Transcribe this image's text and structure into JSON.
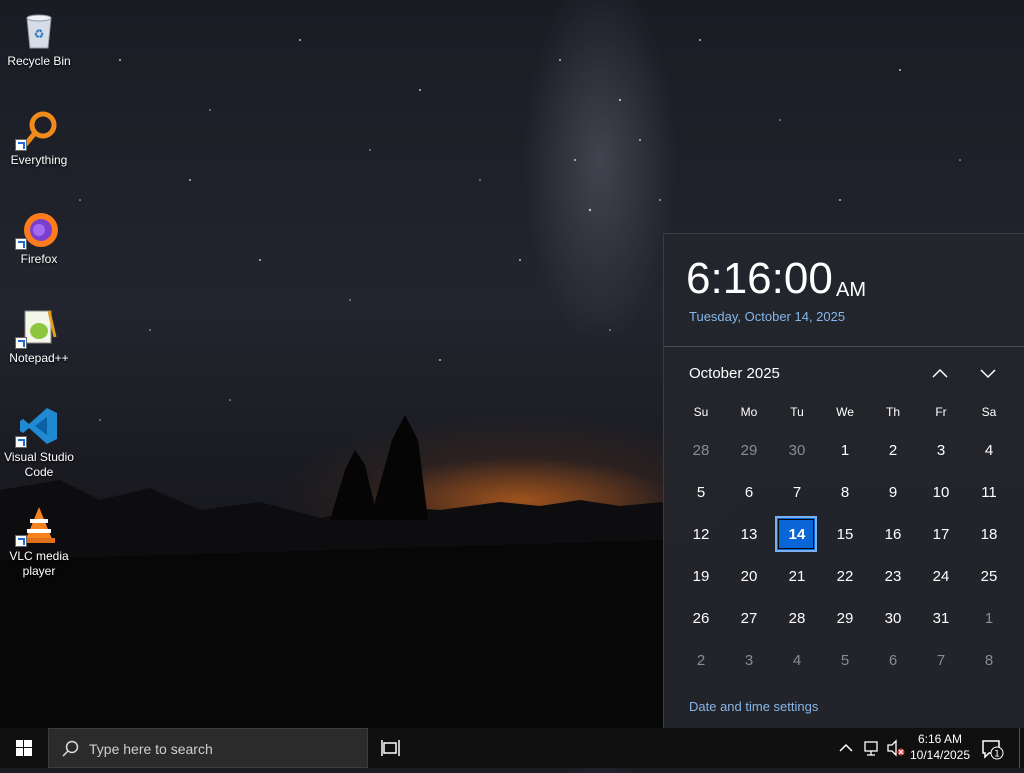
{
  "desktop": {
    "icons": [
      {
        "label_line1": "Recycle Bin",
        "label_line2": "",
        "icon": "recycle-bin-icon"
      },
      {
        "label_line1": "Everything",
        "label_line2": "",
        "icon": "everything-search-icon"
      },
      {
        "label_line1": "Firefox",
        "label_line2": "",
        "icon": "firefox-icon"
      },
      {
        "label_line1": "Notepad++",
        "label_line2": "",
        "icon": "notepad-plus-plus-icon"
      },
      {
        "label_line1": "Visual Studio",
        "label_line2": "Code",
        "icon": "vscode-icon"
      },
      {
        "label_line1": "VLC media",
        "label_line2": "player",
        "icon": "vlc-icon"
      }
    ]
  },
  "calendar": {
    "time": "6:16:00",
    "ampm": "AM",
    "long_date": "Tuesday, October 14, 2025",
    "month_label": "October 2025",
    "weekdays": [
      "Su",
      "Mo",
      "Tu",
      "We",
      "Th",
      "Fr",
      "Sa"
    ],
    "days": [
      "28",
      "29",
      "30",
      "1",
      "2",
      "3",
      "4",
      "5",
      "6",
      "7",
      "8",
      "9",
      "10",
      "11",
      "12",
      "13",
      "14",
      "15",
      "16",
      "17",
      "18",
      "19",
      "20",
      "21",
      "22",
      "23",
      "24",
      "25",
      "26",
      "27",
      "28",
      "29",
      "30",
      "31",
      "1",
      "2",
      "3",
      "4",
      "5",
      "6",
      "7",
      "8"
    ],
    "selected_day": "14",
    "settings_link": "Date and time settings",
    "accent_color": "#0a66d6",
    "link_color": "#86b6ea"
  },
  "taskbar": {
    "search_placeholder": "Type here to search",
    "clock_time": "6:16 AM",
    "clock_date": "10/14/2025",
    "notification_count": "1"
  }
}
